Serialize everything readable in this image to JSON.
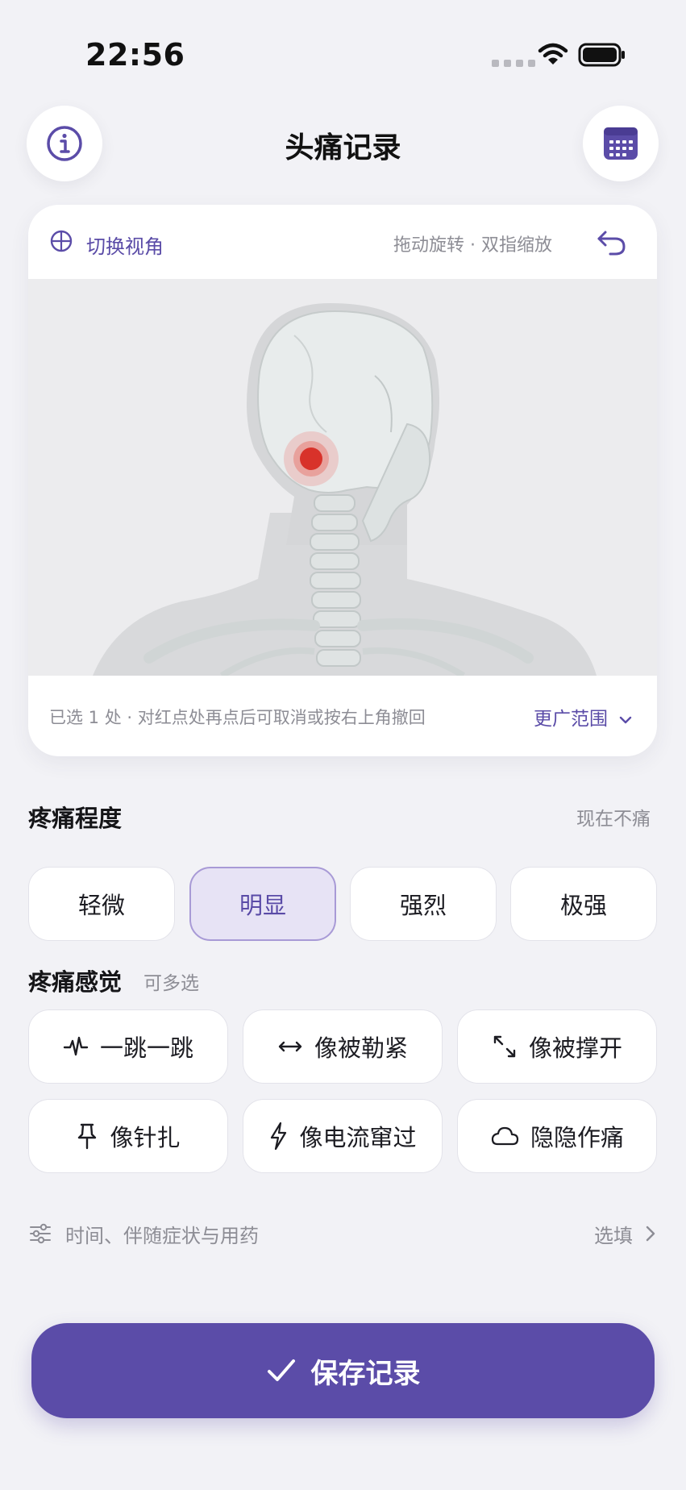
{
  "status_bar": {
    "time": "22:56"
  },
  "header": {
    "title": "头痛记录",
    "left_icon": "info-icon",
    "right_icon": "calendar-icon"
  },
  "model_card": {
    "switch_view_label": "切换视角",
    "gesture_hint": "拖动旋转 · 双指缩放",
    "undo_icon": "undo-icon",
    "selection_hint": "已选 1 处 · 对红点处再点后可取消或按右上角撤回",
    "wider_range_label": "更广范围",
    "marker_color": "#d8322a"
  },
  "severity": {
    "title": "疼痛程度",
    "no_pain_label": "现在不痛",
    "options": [
      "轻微",
      "明显",
      "强烈",
      "极强"
    ],
    "selected": "明显"
  },
  "sensation": {
    "title": "疼痛感觉",
    "multi_hint": "可多选",
    "options": [
      {
        "label": "一跳一跳",
        "icon": "pulse-icon"
      },
      {
        "label": "像被勒紧",
        "icon": "arrows-inward-icon"
      },
      {
        "label": "像被撑开",
        "icon": "arrows-outward-icon"
      },
      {
        "label": "像针扎",
        "icon": "pin-icon"
      },
      {
        "label": "像电流窜过",
        "icon": "lightning-icon"
      },
      {
        "label": "隐隐作痛",
        "icon": "cloud-icon"
      }
    ]
  },
  "optional_row": {
    "label": "时间、伴随症状与用药",
    "side_label": "选填"
  },
  "save_button": {
    "label": "保存记录"
  },
  "colors": {
    "accent": "#5b4ca8",
    "background": "#f2f2f6"
  }
}
